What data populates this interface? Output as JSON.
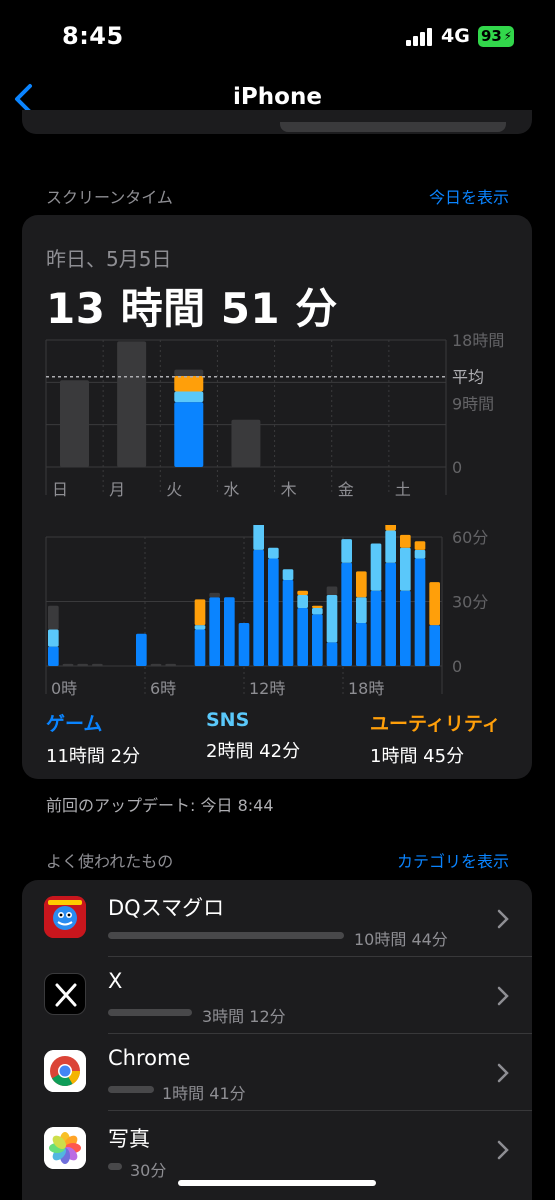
{
  "status_bar": {
    "time": "8:45",
    "network": "4G",
    "battery": "93"
  },
  "nav": {
    "title": "iPhone"
  },
  "screen_time": {
    "section_title": "スクリーンタイム",
    "show_today": "今日を表示",
    "date": "昨日、5月5日",
    "total": "13 時間 51 分",
    "categories": [
      {
        "name": "ゲーム",
        "time": "11時間 2分",
        "color": "#0a84ff"
      },
      {
        "name": "SNS",
        "time": "2時間 42分",
        "color": "#5ac8fa"
      },
      {
        "name": "ユーティリティ",
        "time": "1時間 45分",
        "color": "#ff9f0a"
      }
    ]
  },
  "chart_data": [
    {
      "type": "bar",
      "categories": [
        "日",
        "月",
        "火",
        "水",
        "木",
        "金",
        "土"
      ],
      "y_tick_labels": [
        "18時間",
        "9時間",
        "0"
      ],
      "average_label": "平均",
      "ylim": [
        0,
        18
      ],
      "average_hours": 12.8,
      "series": [
        {
          "name": "ゲーム",
          "values": [
            0,
            0,
            9.2,
            0,
            0,
            0,
            0
          ]
        },
        {
          "name": "SNS",
          "values": [
            0,
            0,
            1.5,
            0,
            0,
            0,
            0
          ]
        },
        {
          "name": "ユーティリティ",
          "values": [
            0,
            0,
            2.2,
            0,
            0,
            0,
            0
          ]
        },
        {
          "name": "other",
          "values": [
            12.3,
            17.8,
            0.9,
            6.7,
            0,
            0,
            0
          ]
        }
      ]
    },
    {
      "type": "bar",
      "categories": [
        "0時",
        "1時",
        "2時",
        "3時",
        "4時",
        "5時",
        "6時",
        "7時",
        "8時",
        "9時",
        "10時",
        "11時",
        "12時",
        "13時",
        "14時",
        "15時",
        "16時",
        "17時",
        "18時",
        "19時",
        "20時",
        "21時",
        "22時",
        "23時"
      ],
      "x_tick_labels": [
        "0時",
        "6時",
        "12時",
        "18時"
      ],
      "y_tick_labels": [
        "60分",
        "30分",
        "0"
      ],
      "ylim": [
        0,
        60
      ],
      "series": [
        {
          "name": "ゲーム",
          "values": [
            9,
            0,
            0,
            0,
            0,
            0,
            15,
            0,
            0,
            0,
            17,
            32,
            32,
            20,
            54,
            50,
            40,
            27,
            24,
            11,
            48,
            20,
            35,
            48,
            35,
            50,
            19
          ]
        },
        {
          "name": "SNS",
          "values": [
            8,
            0,
            0,
            0,
            0,
            0,
            0,
            0,
            0,
            0,
            2,
            0,
            0,
            0,
            17,
            5,
            5,
            6,
            3,
            22,
            11,
            12,
            22,
            15,
            20,
            4,
            0
          ]
        },
        {
          "name": "ユーティリティ",
          "values": [
            0,
            0,
            0,
            0,
            0,
            0,
            0,
            0,
            0,
            0,
            12,
            0,
            0,
            0,
            4,
            0,
            0,
            2,
            1,
            0,
            0,
            12,
            0,
            5,
            6,
            4,
            20
          ]
        },
        {
          "name": "other",
          "values": [
            11,
            1,
            1,
            1,
            0,
            0,
            0,
            1,
            1,
            0,
            0,
            2,
            0,
            0,
            0,
            0,
            0,
            0,
            0,
            4,
            0,
            0,
            0,
            0,
            0,
            0,
            0
          ]
        }
      ]
    }
  ],
  "last_update": "前回のアップデート: 今日 8:44",
  "most_used": {
    "section_title": "よく使われたもの",
    "show_categories": "カテゴリを表示",
    "apps": [
      {
        "name": "DQスマグロ",
        "time": "10時間 44分",
        "fraction": 1.0,
        "icon": "dq-smagro-icon"
      },
      {
        "name": "X",
        "time": "3時間 12分",
        "fraction": 0.3,
        "icon": "x-icon"
      },
      {
        "name": "Chrome",
        "time": "1時間 41分",
        "fraction": 0.16,
        "icon": "chrome-icon"
      },
      {
        "name": "写真",
        "time": "30分",
        "fraction": 0.05,
        "icon": "photos-icon"
      }
    ]
  }
}
